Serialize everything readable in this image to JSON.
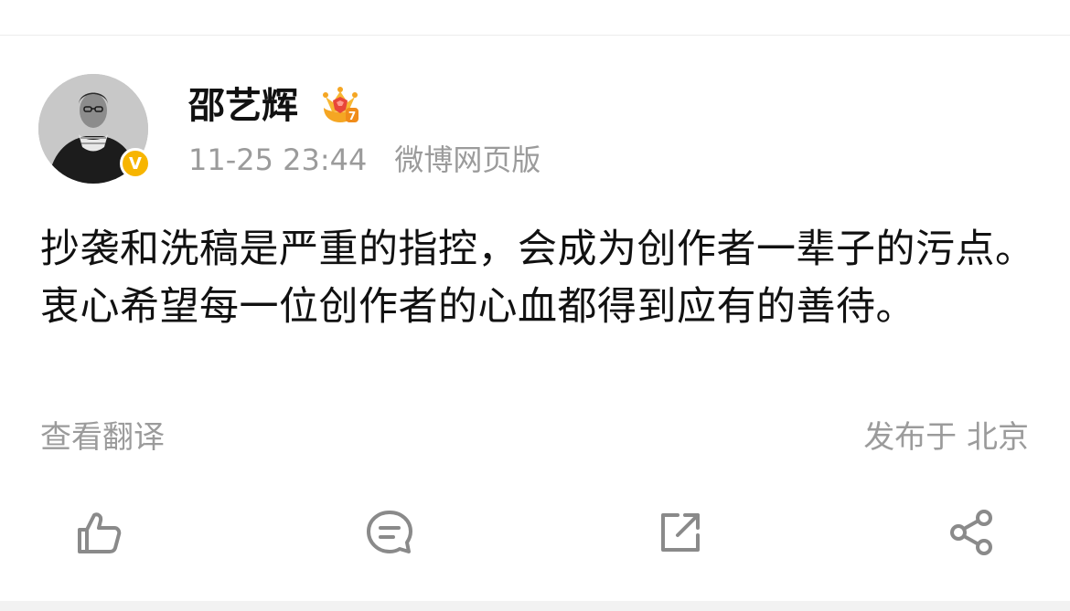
{
  "post": {
    "author": {
      "name": "邵艺辉",
      "avatar_icon": "avatar-photo",
      "verified_badge": "V",
      "vip_icon": "crown-level-icon",
      "vip_level": "7"
    },
    "meta": {
      "timestamp": "11-25 23:44",
      "source": "微博网页版"
    },
    "text": "抄袭和洗稿是严重的指控，会成为创作者一辈子的污点。衷心希望每一位创作者的心血都得到应有的善待。",
    "translate_label": "查看翻译",
    "location": "发布于 北京"
  },
  "actions": [
    {
      "name": "like",
      "icon": "thumbs-up-icon"
    },
    {
      "name": "comment",
      "icon": "comment-bubble-icon"
    },
    {
      "name": "repost",
      "icon": "external-link-icon"
    },
    {
      "name": "share",
      "icon": "share-nodes-icon"
    }
  ],
  "colors": {
    "text_primary": "#111111",
    "text_secondary": "#9b9b9b",
    "verified": "#f7b500",
    "vip_crown": "#f5a623",
    "vip_gem": "#e8463a",
    "icon_stroke": "#8a8a8a"
  }
}
